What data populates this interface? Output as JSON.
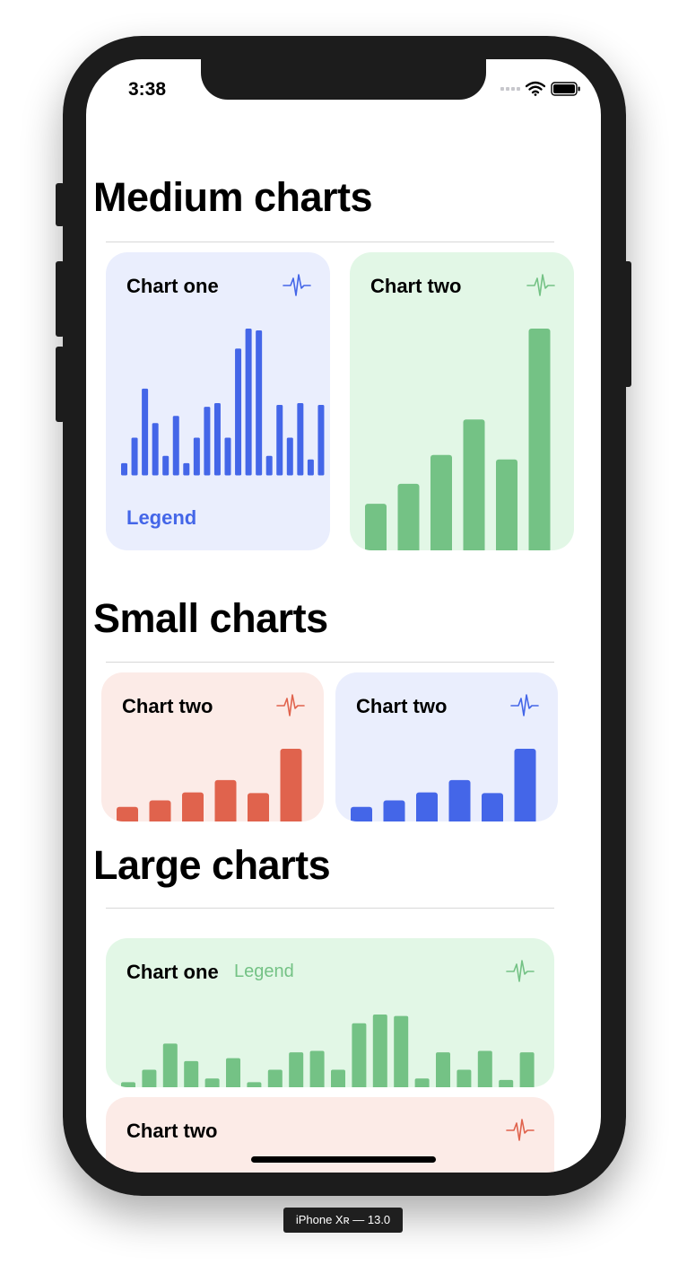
{
  "status_bar": {
    "time": "3:38"
  },
  "device_label": "iPhone Xʀ — 13.0",
  "sections": {
    "medium": {
      "title": "Medium charts"
    },
    "small": {
      "title": "Small charts"
    },
    "large": {
      "title": "Large charts"
    }
  },
  "colors": {
    "blue": "#4466e8",
    "green": "#74c285",
    "red": "#e0634d",
    "blue_bg": "#eaeefd",
    "green_bg": "#e2f7e6",
    "red_bg": "#fcebe7"
  },
  "icons": {
    "chart_icon": "waveform-icon"
  },
  "cards": {
    "medium_one": {
      "title": "Chart one",
      "legend": "Legend"
    },
    "medium_two": {
      "title": "Chart two"
    },
    "small_one": {
      "title": "Chart two"
    },
    "small_two": {
      "title": "Chart two"
    },
    "large_one": {
      "title": "Chart one",
      "legend": "Legend"
    },
    "large_two": {
      "title": "Chart two"
    }
  },
  "chart_data": [
    {
      "type": "bar",
      "values": [
        6,
        20,
        47,
        28,
        10,
        32,
        6,
        20,
        37,
        39,
        20,
        69,
        80,
        79,
        10,
        38,
        20,
        39,
        8,
        38
      ]
    },
    {
      "type": "bar",
      "values": [
        21,
        30,
        43,
        59,
        41,
        100
      ]
    },
    {
      "type": "bar",
      "values": [
        20,
        29,
        40,
        57,
        39,
        100
      ]
    },
    {
      "type": "bar",
      "values": [
        20,
        29,
        40,
        57,
        39,
        100
      ]
    },
    {
      "type": "bar",
      "values": [
        7,
        24,
        60,
        36,
        12,
        40,
        7,
        24,
        48,
        50,
        24,
        88,
        100,
        98,
        12,
        48,
        24,
        50,
        10,
        48
      ]
    }
  ]
}
